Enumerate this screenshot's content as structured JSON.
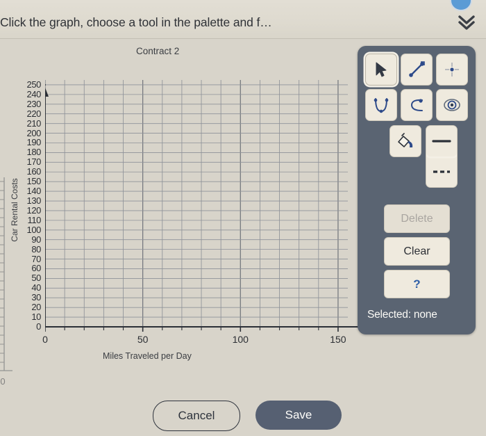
{
  "header": {
    "instruction": "Click the graph, choose a tool in the palette and f…",
    "collapse_icon": "double-chevron-down-icon"
  },
  "graph": {
    "title": "Contract 2",
    "y_axis_label": "Car Rental Costs",
    "x_axis_label": "Miles Traveled per Day"
  },
  "palette": {
    "tools": [
      {
        "name": "pointer-tool",
        "label": "Pointer",
        "selected": true
      },
      {
        "name": "segment-tool",
        "label": "Segment",
        "selected": false
      },
      {
        "name": "point-tool",
        "label": "Point",
        "selected": false
      },
      {
        "name": "parabola-tool",
        "label": "Parabola",
        "selected": false
      },
      {
        "name": "curve-tool",
        "label": "Curve",
        "selected": false
      },
      {
        "name": "circle-tool",
        "label": "Circle",
        "selected": false
      }
    ],
    "fill_tool": {
      "name": "fill-bucket-tool",
      "label": "Fill"
    },
    "line_styles": [
      {
        "name": "solid-line-style",
        "label": "Solid",
        "active": true
      },
      {
        "name": "dashed-line-style",
        "label": "Dashed",
        "active": false
      }
    ],
    "buttons": {
      "delete": "Delete",
      "clear": "Clear",
      "help": "?"
    },
    "status": "Selected: none",
    "panel_color": "#5a6472",
    "button_color": "#efeade"
  },
  "footer": {
    "cancel_label": "Cancel",
    "save_label": "Save",
    "save_bg": "#566072"
  },
  "chart_data": {
    "type": "line",
    "title": "Contract 2",
    "xlabel": "Miles Traveled per Day",
    "ylabel": "Car Rental Costs",
    "xlim": [
      0,
      155
    ],
    "ylim": [
      0,
      255
    ],
    "x_ticks_major": [
      0,
      50,
      100,
      150
    ],
    "x_tick_labels": [
      "0",
      "50",
      "100",
      "150"
    ],
    "x_ticks_minor_step": 10,
    "y_ticks_major": [
      0,
      10,
      20,
      30,
      40,
      50,
      60,
      70,
      80,
      90,
      100,
      110,
      120,
      130,
      140,
      150,
      160,
      170,
      180,
      190,
      200,
      210,
      220,
      230,
      240,
      250
    ],
    "y_tick_labels": [
      "0",
      "10",
      "20",
      "30",
      "40",
      "50",
      "60",
      "70",
      "80",
      "90",
      "100",
      "110",
      "120",
      "130",
      "140",
      "150",
      "160",
      "170",
      "180",
      "190",
      "200",
      "210",
      "220",
      "230",
      "240",
      "250"
    ],
    "grid": true,
    "grid_x_step": 10,
    "grid_y_step": 10,
    "legend": null,
    "series": [],
    "annotations": []
  }
}
